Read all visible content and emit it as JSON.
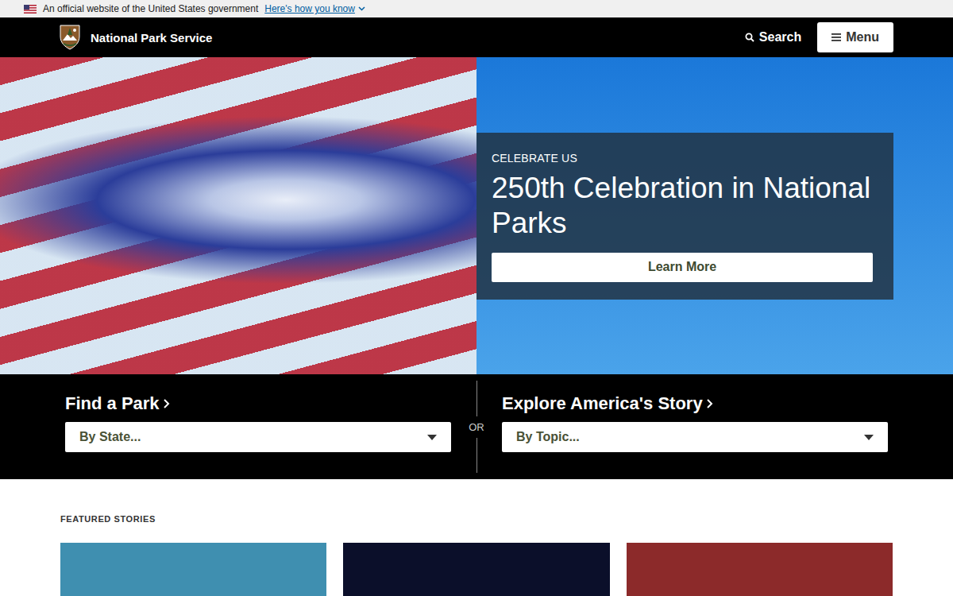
{
  "banner": {
    "text": "An official website of the United States government",
    "link": "Here's how you know"
  },
  "header": {
    "title": "National Park Service",
    "search": "Search",
    "menu": "Menu"
  },
  "hero": {
    "eyebrow": "CELEBRATE US",
    "title": "250th Celebration in National Parks",
    "button": "Learn More"
  },
  "finders": [
    {
      "heading": "Find a Park",
      "select": "By State..."
    },
    {
      "heading": "Explore America's Story",
      "select": "By Topic..."
    }
  ],
  "separator": "OR",
  "featured": {
    "heading": "FEATURED STORIES",
    "cards": [
      {
        "color": "#3f8fb0"
      },
      {
        "color": "#0b0f2a"
      },
      {
        "color": "#8c2a2a"
      }
    ]
  }
}
